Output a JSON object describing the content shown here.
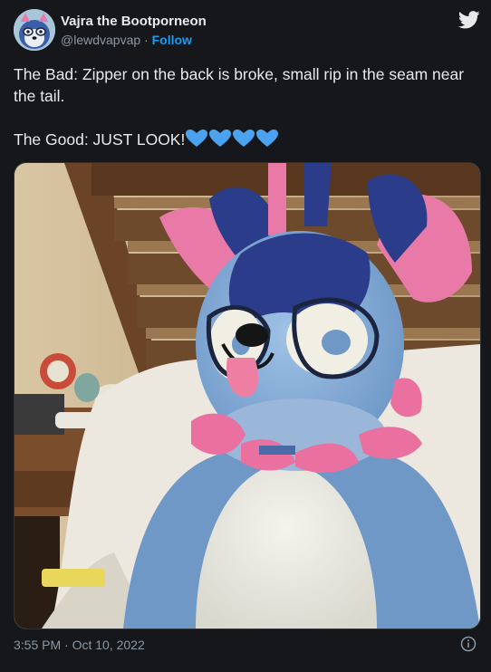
{
  "author": {
    "display_name": "Vajra the Bootporneon",
    "handle": "@lewdvapvap",
    "separator": "·",
    "follow_label": "Follow"
  },
  "tweet": {
    "line1": "The Bad: Zipper on the back is broke, small rip in the seam near the tail.",
    "line2": "The Good: JUST LOOK!",
    "hearts": "💙💙💙💙"
  },
  "footer": {
    "timestamp": "3:55 PM · Oct 10, 2022"
  },
  "icons": {
    "brand": "twitter-bird-icon",
    "info": "info-icon"
  },
  "colors": {
    "background": "#15171b",
    "text": "#e7e9ea",
    "muted": "#8b98a5",
    "accent": "#1d9bf0",
    "heart": "#3aa0f0"
  }
}
